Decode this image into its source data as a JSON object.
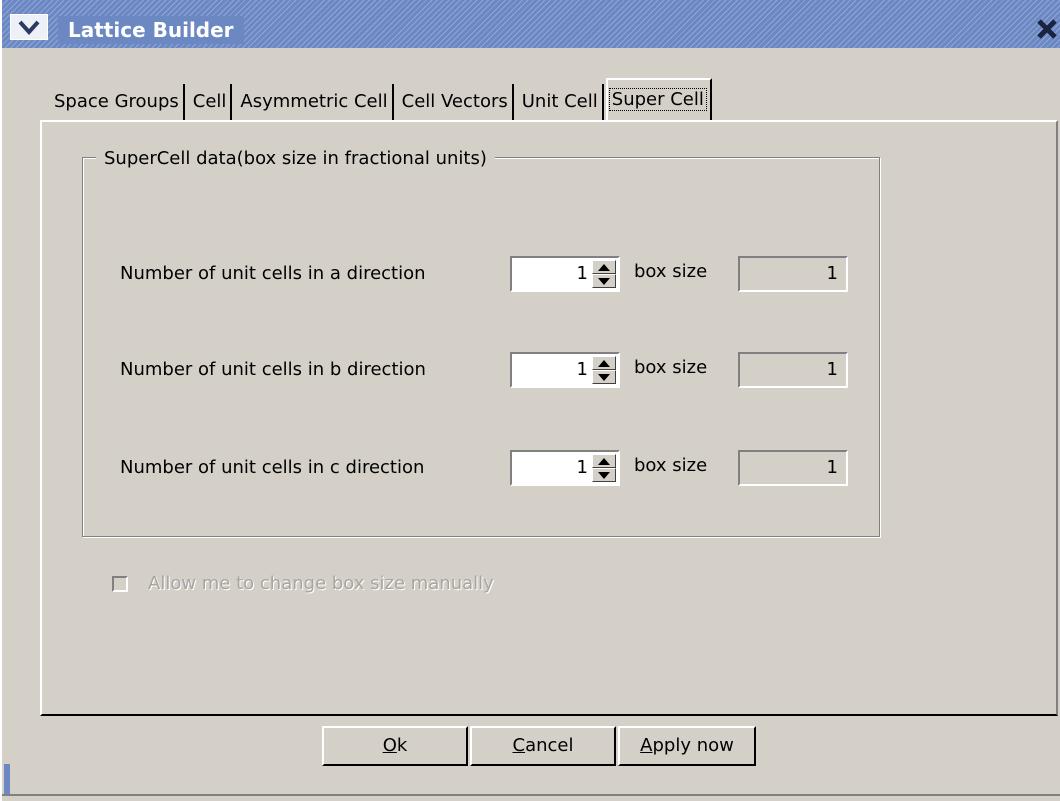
{
  "window": {
    "title": "Lattice Builder"
  },
  "tabs": [
    {
      "label": "Space Groups",
      "active": false
    },
    {
      "label": "Cell",
      "active": false
    },
    {
      "label": "Asymmetric Cell",
      "active": false
    },
    {
      "label": "Cell Vectors",
      "active": false
    },
    {
      "label": "Unit Cell",
      "active": false
    },
    {
      "label": "Super Cell",
      "active": true
    }
  ],
  "group": {
    "title": "SuperCell data(box size in fractional units)",
    "rows": [
      {
        "label": "Number of unit cells in a direction",
        "count": "1",
        "box_label": "box size",
        "box_value": "1"
      },
      {
        "label": "Number of unit cells in b direction",
        "count": "1",
        "box_label": "box size",
        "box_value": "1"
      },
      {
        "label": "Number of unit cells in c direction",
        "count": "1",
        "box_label": "box size",
        "box_value": "1"
      }
    ]
  },
  "checkbox": {
    "label": "Allow me to change box size manually",
    "checked": false,
    "enabled": false
  },
  "buttons": {
    "ok": {
      "mnemonic": "O",
      "rest": "k"
    },
    "cancel": {
      "mnemonic": "C",
      "rest": "ancel"
    },
    "apply": {
      "mnemonic": "A",
      "rest": "pply now"
    }
  },
  "icons": {
    "window_menu": "chevron-down-icon",
    "close": "close-icon",
    "spin_up": "arrow-up-icon",
    "spin_down": "arrow-down-icon"
  },
  "colors": {
    "titlebar": "#6c88c2",
    "background": "#d4d0c8"
  }
}
